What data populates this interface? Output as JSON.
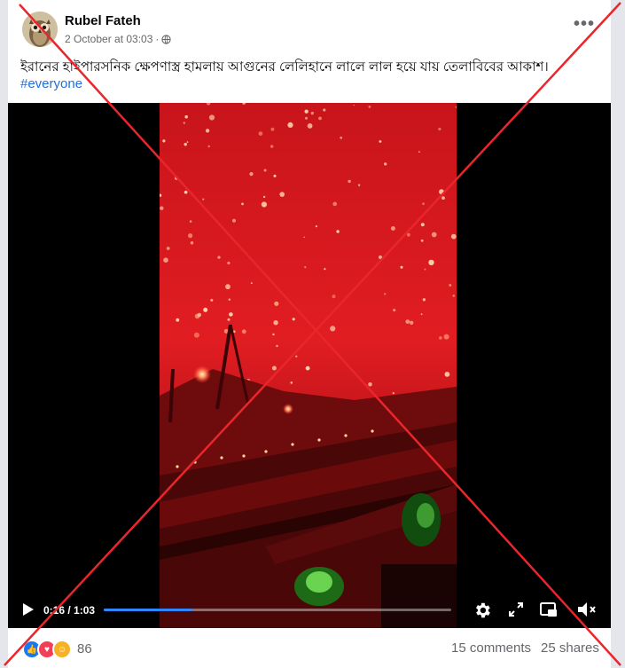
{
  "post": {
    "author": "Rubel Fateh",
    "date": "2 October at 03:03",
    "date_separator": "·",
    "caption": "ইরানের হাইপারসনিক ক্ষেপণাস্ত্র হামলায়  আগুনের লেলিহানে লালে লাল হয়ে যায় তেলাবিবের আকাশ।",
    "hashtag": "#everyone",
    "more_label": "•••"
  },
  "video": {
    "time": "0:16 / 1:03",
    "progress": 0.254
  },
  "footer": {
    "reaction_count": "86",
    "comments": "15 comments",
    "shares": "25 shares",
    "reactions": [
      "like-icon",
      "love-icon",
      "care-icon"
    ]
  },
  "colors": {
    "accent": "#216fdb",
    "progress": "#2d88ff",
    "cross": "#e8262c",
    "sky": "#d9141a"
  }
}
